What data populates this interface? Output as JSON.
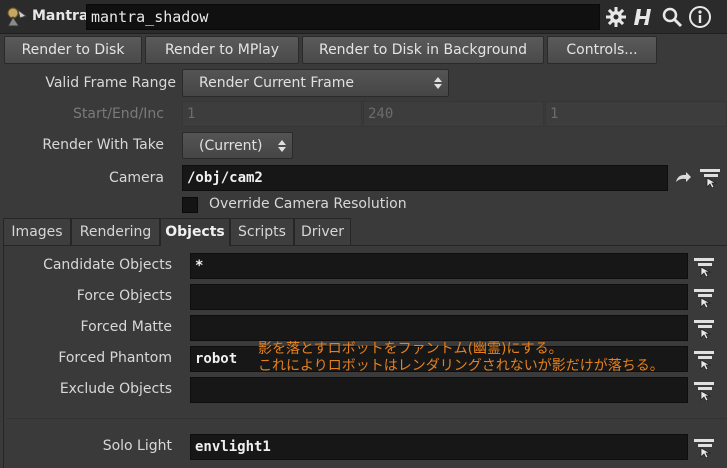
{
  "header": {
    "node_type": "Mantra",
    "node_name": "mantra_shadow",
    "icons": [
      "gear-icon",
      "help-icon",
      "search-icon",
      "info-icon"
    ]
  },
  "buttons": {
    "render_to_disk": "Render to Disk",
    "render_to_mplay": "Render to MPlay",
    "render_background": "Render to Disk in Background",
    "controls": "Controls..."
  },
  "params": {
    "valid_frame_range_label": "Valid Frame Range",
    "valid_frame_range_value": "Render Current Frame",
    "start_end_inc_label": "Start/End/Inc",
    "start": "1",
    "end": "240",
    "inc": "1",
    "render_with_take_label": "Render With Take",
    "render_with_take_value": "(Current)",
    "camera_label": "Camera",
    "camera_value": "/obj/cam2",
    "override_resolution_label": "Override Camera Resolution"
  },
  "tabs": [
    "Images",
    "Rendering",
    "Objects",
    "Scripts",
    "Driver"
  ],
  "active_tab": "Objects",
  "objects": {
    "candidate_label": "Candidate Objects",
    "candidate_value": "*",
    "force_label": "Force Objects",
    "force_value": "",
    "matte_label": "Forced Matte",
    "matte_value": "",
    "phantom_label": "Forced Phantom",
    "phantom_value": "robot",
    "exclude_label": "Exclude Objects",
    "exclude_value": "",
    "solo_light_label": "Solo Light",
    "solo_light_value": "envlight1"
  },
  "annotation": {
    "line1": "影を落とすロボットをファントム(幽霊)にする。",
    "line2": "これによりロボットはレンダリングされないが影だけが落ちる。",
    "color": "#e6801e"
  }
}
